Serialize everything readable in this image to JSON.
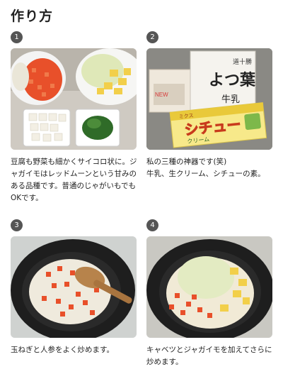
{
  "page": {
    "title": "作り方"
  },
  "steps": [
    {
      "number": "1",
      "text": "豆腐も野菜も細かくサイコロ状に。ジャガイモはレッドムーンという甘みのある品種です。普通のじゃがいもでもOKです。"
    },
    {
      "number": "2",
      "text": "私の三種の神器です(笑)\n牛乳、生クリーム、シチューの素。",
      "package_text": {
        "milk": "道十勝",
        "milk_big": "よつ葉",
        "milk_sub": "牛乳",
        "stew_brand": "ミクス",
        "stew_name": "シチュー",
        "stew_sub": "クリーム",
        "new": "NEW"
      }
    },
    {
      "number": "3",
      "text": "玉ねぎと人参をよく炒めます。"
    },
    {
      "number": "4",
      "text": "キャベツとジャガイモを加えてさらに炒めます。"
    }
  ],
  "colors": {
    "badge": "#555555",
    "carrot": "#e8502a",
    "potato": "#f2cf4a",
    "cabbage": "#dfe8b8",
    "pan": "#1e1e1e"
  }
}
